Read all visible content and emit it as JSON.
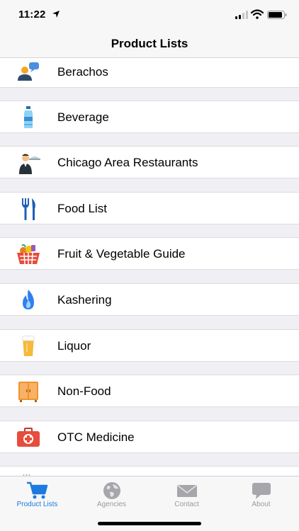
{
  "status_bar": {
    "time": "11:22"
  },
  "nav": {
    "title": "Product Lists"
  },
  "list": {
    "items": [
      {
        "label": "Berachos",
        "icon": "people-chat-icon"
      },
      {
        "label": "Beverage",
        "icon": "water-bottle-icon"
      },
      {
        "label": "Chicago Area Restaurants",
        "icon": "waiter-icon"
      },
      {
        "label": "Food List",
        "icon": "fork-knife-icon"
      },
      {
        "label": "Fruit & Vegetable Guide",
        "icon": "produce-basket-icon"
      },
      {
        "label": "Kashering",
        "icon": "flame-icon"
      },
      {
        "label": "Liquor",
        "icon": "beer-glass-icon"
      },
      {
        "label": "Non-Food",
        "icon": "cabinet-icon"
      },
      {
        "label": "OTC Medicine",
        "icon": "first-aid-kit-icon"
      }
    ]
  },
  "tab_bar": {
    "tabs": [
      {
        "label": "Product Lists",
        "icon": "shopping-cart-icon",
        "active": true
      },
      {
        "label": "Agencies",
        "icon": "globe-icon",
        "active": false
      },
      {
        "label": "Contact",
        "icon": "envelope-icon",
        "active": false
      },
      {
        "label": "About",
        "icon": "speech-bubble-icon",
        "active": false
      }
    ]
  },
  "colors": {
    "accent": "#1d7ae0",
    "inactive": "#9a9a9e",
    "group_bg": "#efeff4"
  }
}
